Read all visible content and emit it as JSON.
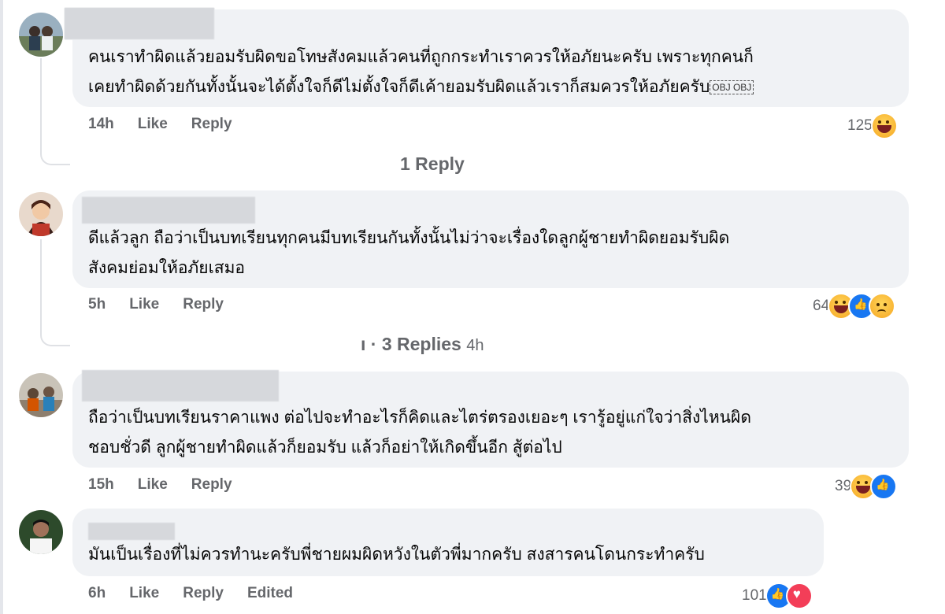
{
  "comments": [
    {
      "text_lines": [
        "คนเราทำผิดแล้วยอมรับผิดขอโทษสังคมแล้วคนที่ถูกกระทำเราควรให้อภัยนะครับ เพราะทุกคนก็",
        "เคยทำผิดด้วยกันทั้งนั้นจะได้ตั้งใจก็ดีไม่ตั้งใจก็ดีเค้ายอมรับผิดแล้วเราก็สมควรให้อภัยครับ"
      ],
      "inline_emoji": "OBJ OBJ",
      "time": "14h",
      "like_label": "Like",
      "reply_label": "Reply",
      "reaction_count": "125",
      "reactions": [
        "haha"
      ],
      "replies_link": "1 Reply"
    },
    {
      "text_lines": [
        "ดีแล้วลูก ถือว่าเป็นบทเรียนทุกคนมีบทเรียนกันทั้งนั้นไม่ว่าจะเรื่องใดลูกผู้ชายทำผิดยอมรับผิด",
        "สังคมย่อมให้อภัยเสมอ"
      ],
      "time": "5h",
      "like_label": "Like",
      "reply_label": "Reply",
      "reaction_count": "64",
      "reactions": [
        "haha",
        "like",
        "sad"
      ],
      "replies_link_prefix": "ı · ",
      "replies_link": "3 Replies",
      "replies_link_time": "4h"
    },
    {
      "text_lines": [
        "ถือว่าเป็นบทเรียนราคาแพง ต่อไปจะทำอะไรก็คิดและไตร่ตรองเยอะๆ เรารู้อยู่แก่ใจว่าสิ่งไหนผิด",
        "ชอบชั่วดี ลูกผู้ชายทำผิดแล้วก็ยอมรับ แล้วก็อย่าให้เกิดขึ้นอีก สู้ต่อไป"
      ],
      "time": "15h",
      "like_label": "Like",
      "reply_label": "Reply",
      "reaction_count": "39",
      "reactions": [
        "haha",
        "like"
      ]
    },
    {
      "text_lines": [
        "มันเป็นเรื่องที่ไม่ควรทำนะครับพี่ชายผมผิดหวังในตัวพี่มากครับ สงสารคนโดนกระทำครับ"
      ],
      "time": "6h",
      "like_label": "Like",
      "reply_label": "Reply",
      "edited_label": "Edited",
      "reaction_count": "101",
      "reactions": [
        "like",
        "love"
      ]
    }
  ],
  "colors": {
    "bubble": "#f0f2f5",
    "meta_text": "#65676b",
    "body_text": "#050505",
    "like_blue": "#1877f2",
    "love_red": "#f33e58"
  }
}
